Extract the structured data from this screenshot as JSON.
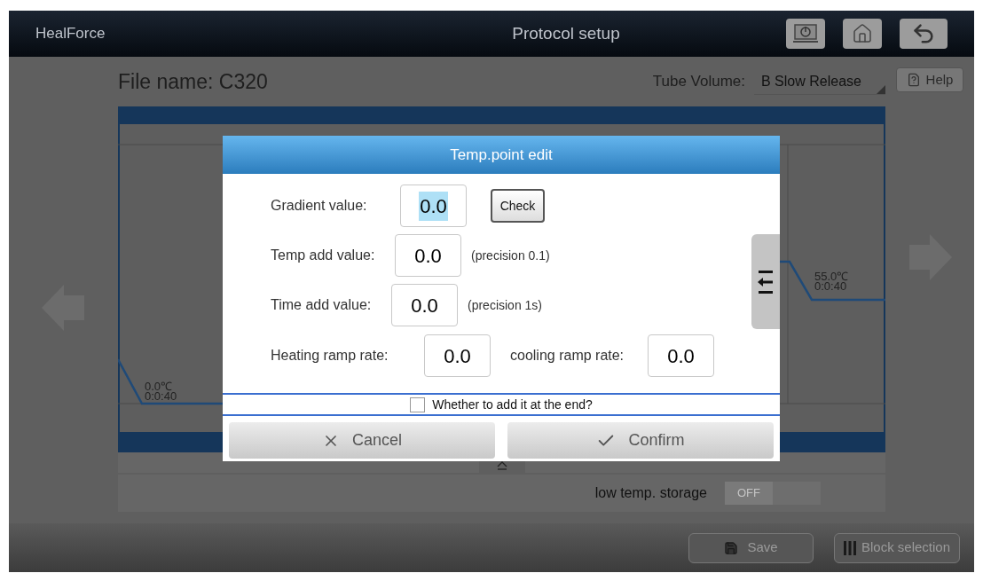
{
  "header": {
    "brand": "HealForce",
    "title": "Protocol setup"
  },
  "file": {
    "label": "File name:",
    "value": "C320"
  },
  "tube_volume": {
    "label": "Tube Volume:",
    "value": "B Slow Release"
  },
  "help": {
    "label": "Help"
  },
  "chart_points": [
    {
      "temp": "0.0℃",
      "time": "0:0:40"
    },
    {
      "temp": "55.0℃",
      "time": "0:0:40"
    }
  ],
  "low_temp_storage": {
    "label": "low temp. storage",
    "toggle": "OFF",
    "on": false
  },
  "footer": {
    "buttons": [
      "Save",
      "Block selection"
    ]
  },
  "dialog": {
    "title": "Temp.point edit",
    "gradient": {
      "label": "Gradient value:",
      "value": "0.0",
      "button": "Check"
    },
    "temp_add": {
      "label": "Temp add value:",
      "value": "0.0",
      "hint": "(precision 0.1)"
    },
    "time_add": {
      "label": "Time add value:",
      "value": "0.0",
      "hint": "(precision 1s)"
    },
    "heating": {
      "label": "Heating ramp rate:",
      "value": "0.0"
    },
    "cooling": {
      "label": "cooling ramp rate:",
      "value": "0.0"
    },
    "add_at_end": {
      "label": "Whether to add it at the end?",
      "checked": false
    },
    "cancel": "Cancel",
    "confirm": "Confirm"
  }
}
